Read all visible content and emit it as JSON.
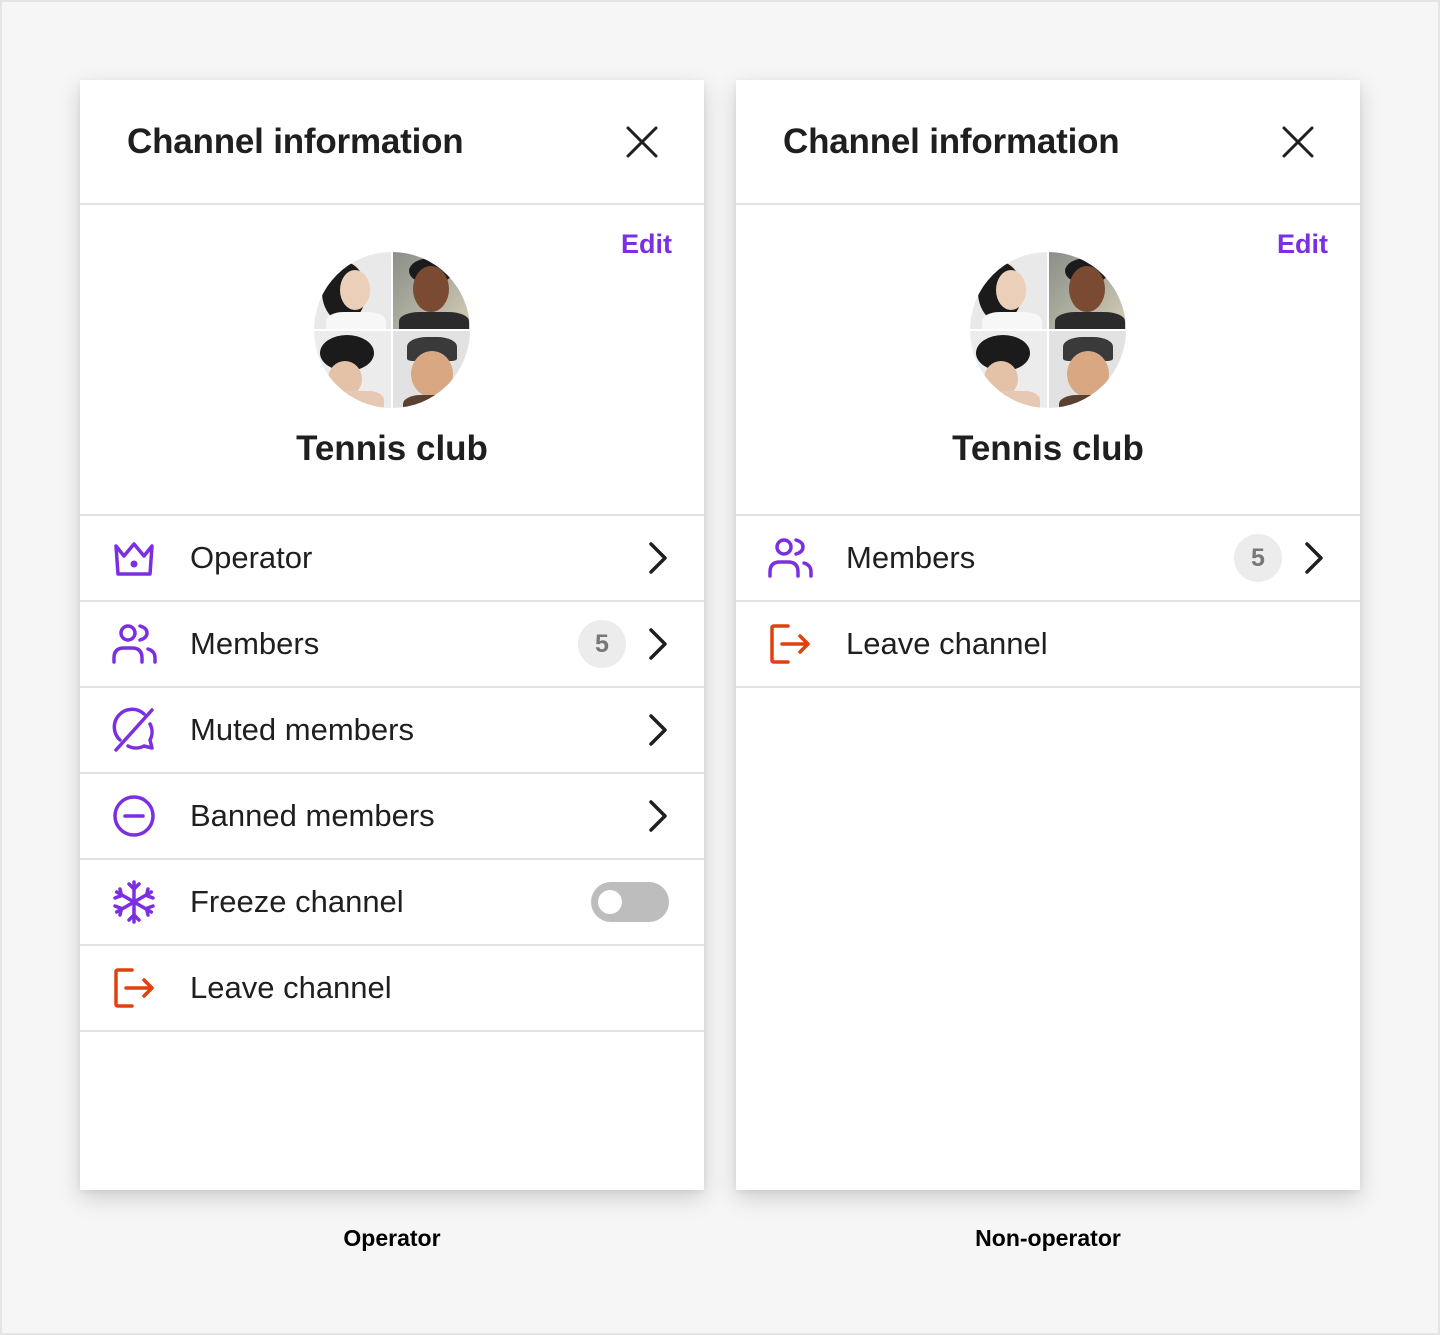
{
  "colors": {
    "accent": "#7b2fe0",
    "danger": "#e0410e",
    "text": "#1f1f1f",
    "divider": "#e2e2e2",
    "badge_bg": "#ececec",
    "toggle_off": "#bdbdbd"
  },
  "panels": [
    {
      "caption": "Operator",
      "header": {
        "title": "Channel information",
        "close_icon": "close-icon"
      },
      "profile": {
        "edit_label": "Edit",
        "channel_name": "Tennis club",
        "avatar": "group-avatar-4-members"
      },
      "menu": [
        {
          "icon": "crown-icon",
          "label": "Operator",
          "trailing": "chevron"
        },
        {
          "icon": "members-icon",
          "label": "Members",
          "badge": "5",
          "trailing": "chevron"
        },
        {
          "icon": "muted-icon",
          "label": "Muted members",
          "trailing": "chevron"
        },
        {
          "icon": "ban-icon",
          "label": "Banned members",
          "trailing": "chevron"
        },
        {
          "icon": "freeze-icon",
          "label": "Freeze channel",
          "trailing": "toggle",
          "toggle_on": false
        },
        {
          "icon": "leave-icon",
          "label": "Leave channel",
          "trailing": "none"
        }
      ]
    },
    {
      "caption": "Non-operator",
      "header": {
        "title": "Channel information",
        "close_icon": "close-icon"
      },
      "profile": {
        "edit_label": "Edit",
        "channel_name": "Tennis club",
        "avatar": "group-avatar-4-members"
      },
      "menu": [
        {
          "icon": "members-icon",
          "label": "Members",
          "badge": "5",
          "trailing": "chevron"
        },
        {
          "icon": "leave-icon",
          "label": "Leave channel",
          "trailing": "none"
        }
      ]
    }
  ]
}
